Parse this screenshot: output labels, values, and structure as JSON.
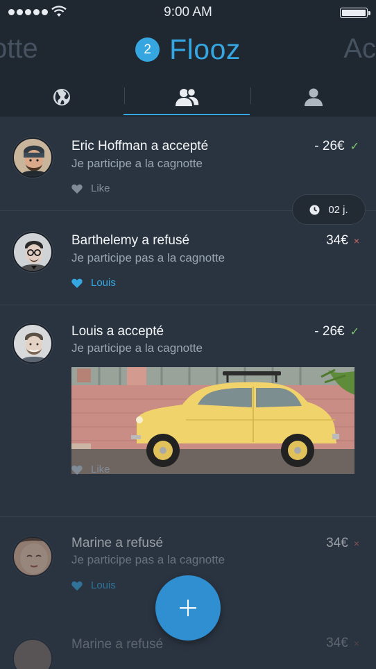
{
  "status_bar": {
    "time": "9:00 AM",
    "signal_icon": "signal-dots-icon",
    "wifi_icon": "wifi-icon",
    "battery_icon": "battery-icon",
    "battery_level": 1.0
  },
  "header": {
    "left_title": "otte",
    "badge_count": "2",
    "brand": "Flooz",
    "right_title": "Acc",
    "accent_color": "#36a6e0"
  },
  "tabs": [
    {
      "icon": "globe-icon",
      "active": false
    },
    {
      "icon": "friends-icon",
      "active": true
    },
    {
      "icon": "person-icon",
      "active": false
    }
  ],
  "feed": [
    {
      "name": "Eric Hoffman a accepté",
      "description": "Je participe a la cagnotte",
      "amount": "- 26€",
      "status": "accepted",
      "like_label": "Like",
      "liked": false
    },
    {
      "name": "Barthelemy a refusé",
      "description": "Je participe pas a la cagnotte",
      "amount": "34€",
      "status": "refused",
      "like_label": "Louis",
      "liked": true
    },
    {
      "name": "Louis a accepté",
      "description": "Je participe a la cagnotte",
      "amount": "- 26€",
      "status": "accepted",
      "like_label": "Like",
      "liked": false,
      "image": "yellow-car-photo"
    },
    {
      "name": "Marine a refusé",
      "description": "Je participe pas a la cagnotte",
      "amount": "34€",
      "status": "refused",
      "like_label": "Louis",
      "liked": true
    },
    {
      "name": "Marine a refusé",
      "amount": "34€",
      "status": "refused"
    }
  ],
  "timer": {
    "icon": "clock-icon",
    "label": "02 j."
  },
  "fab": {
    "icon": "plus-icon",
    "color": "#2f8fd0"
  },
  "marks": {
    "ok": "✓",
    "no": "×"
  }
}
